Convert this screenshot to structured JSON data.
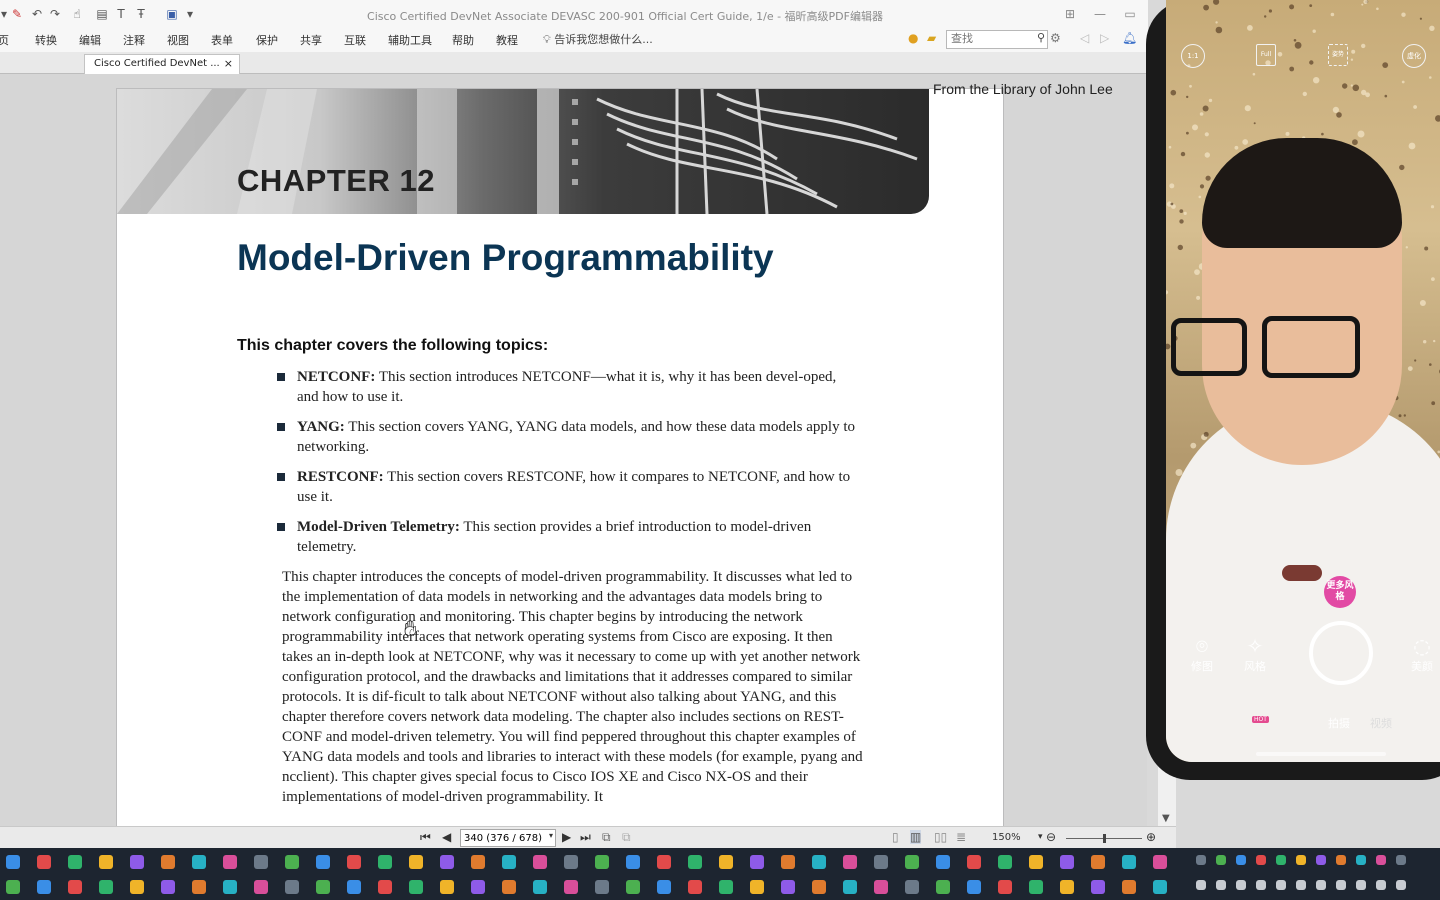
{
  "window": {
    "title": "Cisco Certified DevNet Associate DEVASC 200-901 Official Cert Guide, 1/e - 福昕高级PDF编辑器"
  },
  "menu": {
    "items": [
      "页",
      "转换",
      "编辑",
      "注释",
      "视图",
      "表单",
      "保护",
      "共享",
      "互联",
      "辅助工具",
      "帮助",
      "教程"
    ],
    "tell_me": "告诉我您想做什么..."
  },
  "search": {
    "placeholder": "查找"
  },
  "tab": {
    "label": "Cisco Certified DevNet ...",
    "close": "×"
  },
  "page": {
    "running_head": "From the Library of John Lee",
    "chapter_label": "CHAPTER 12",
    "chapter_title": "Model-Driven Programmability",
    "topics_heading": "This chapter covers the following topics:",
    "topics": [
      {
        "term": "NETCONF:",
        "text": " This section introduces NETCONF—what it is, why it has been devel-oped, and how to use it."
      },
      {
        "term": "YANG:",
        "text": " This section covers YANG, YANG data models, and how these data models apply to networking."
      },
      {
        "term": "RESTCONF:",
        "text": " This section covers RESTCONF, how it compares to NETCONF, and how to use it."
      },
      {
        "term": "Model-Driven Telemetry:",
        "text": " This section provides a brief introduction to model-driven telemetry."
      }
    ],
    "intro": "This chapter introduces the concepts of model-driven programmability. It discusses what led to the implementation of data models in networking and the advantages data models bring to network configuration and monitoring. This chapter begins by introducing the network programmability interfaces that network operating systems from Cisco are exposing. It then takes an in-depth look at NETCONF, why was it necessary to come up with yet another network configuration protocol, and the drawbacks and limitations that it addresses compared to similar protocols. It is dif-ficult to talk about NETCONF without also talking about YANG, and this chapter therefore covers network data modeling. The chapter also includes sections on REST-CONF and model-driven telemetry. You will find peppered throughout this chapter examples of YANG data models and tools and libraries to interact with these models (for example, pyang and ncclient). This chapter gives special focus to Cisco IOS XE and Cisco NX-OS and their implementations of model-driven programmability. It"
  },
  "status": {
    "page_field": "340 (376 / 678)",
    "zoom": "150%",
    "zoom_fraction": 0.5
  },
  "camera": {
    "top_icons": [
      "1:1",
      "Full",
      "姿势",
      "虚化"
    ],
    "style_badge": "更多风格",
    "left_controls": [
      "修图",
      "风格"
    ],
    "right_control": "美颜",
    "modes": [
      "拍摄",
      "视频"
    ]
  },
  "colors": {
    "title_blue": "#0b3554",
    "camera_badge": "#e24aa4",
    "taskbar": "#1d2530"
  },
  "icons": {
    "zoom_out": "minus-circle-icon",
    "zoom_in": "plus-circle-icon",
    "cursor": "grab-hand-icon"
  }
}
